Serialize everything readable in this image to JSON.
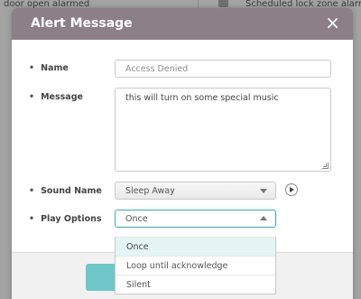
{
  "background": {
    "text_left": "door open alarmed",
    "text_right": "Scheduled lock zone alarm d"
  },
  "modal": {
    "title": "Alert Message",
    "close_glyph": "×"
  },
  "form": {
    "name_label": "Name",
    "name_placeholder": "Access Denied",
    "message_label": "Message",
    "message_value": "this will turn on some special music",
    "sound_label": "Sound Name",
    "sound_value": "Sleep Away",
    "play_label": "Play Options",
    "play_value": "Once"
  },
  "dropdown": {
    "options": [
      "Once",
      "Loop until acknowledge",
      "Silent"
    ],
    "selected_index": 0
  },
  "colors": {
    "header": "#8c7f86",
    "accent": "#6fc7c9"
  },
  "icons": {
    "close": "close-icon",
    "play": "play-icon",
    "caret": "chevron-icon"
  }
}
